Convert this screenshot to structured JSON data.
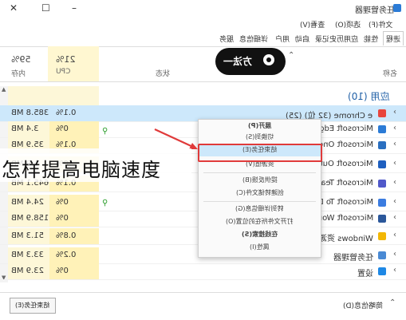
{
  "window": {
    "title": "任务管理器",
    "min": "–",
    "max": "☐",
    "close": "✕"
  },
  "menu": [
    "文件(F)",
    "选项(O)",
    "查看(V)"
  ],
  "tabs": [
    "进程",
    "性能",
    "应用历史记录",
    "启动",
    "用户",
    "详细信息",
    "服务"
  ],
  "header": {
    "name": "名称",
    "status": "状态",
    "cpu_pct": "21%",
    "cpu": "CPU",
    "mem_pct": "59%",
    "mem": "内存"
  },
  "badge": {
    "label": "方法一"
  },
  "group": {
    "label": "应用 (10)"
  },
  "rows": [
    {
      "name": "Google Chrome (32 位) (25)",
      "cpu": "0.1%",
      "mem": "385.8 MB"
    },
    {
      "name": "Microsoft Edge",
      "cpu": "0%",
      "mem": "3.4 MB"
    },
    {
      "name": "Microsoft One",
      "cpu": "0.1%",
      "mem": "35.9 MB"
    },
    {
      "name": "Microsoft Outl",
      "cpu": "0%",
      "mem": "1.9 MB"
    },
    {
      "name": "Microsoft Tean",
      "cpu": "0.1%",
      "mem": "645.1 MB"
    },
    {
      "name": "Microsoft To D",
      "cpu": "0%",
      "mem": "24.4 MB"
    },
    {
      "name": "Microsoft Wor",
      "cpu": "0%",
      "mem": "158.9 MB"
    },
    {
      "name": "Windows 资源",
      "cpu": "0.8%",
      "mem": "51.3 MB"
    },
    {
      "name": "任务管理器",
      "cpu": "0.2%",
      "mem": "33.3 MB"
    },
    {
      "name": "设置",
      "cpu": "0%",
      "mem": "23.9 MB"
    }
  ],
  "context_menu": [
    "展开(P)",
    "切换到(S)",
    "结束任务(E)",
    "资源值(V)",
    "提供反馈(B)",
    "创建转储文件(C)",
    "转到详细信息(G)",
    "打开文件所在的位置(O)",
    "在线搜索(S)",
    "属性(I)"
  ],
  "overlay_text": "怎样提高电脑速度",
  "bottom": {
    "fewer": "简略信息(D)",
    "end_task": "结束任务(E)"
  },
  "colors": {
    "cpu_col": "#fff2b8",
    "highlight": "#cde8fb",
    "red": "#e03a3a"
  }
}
